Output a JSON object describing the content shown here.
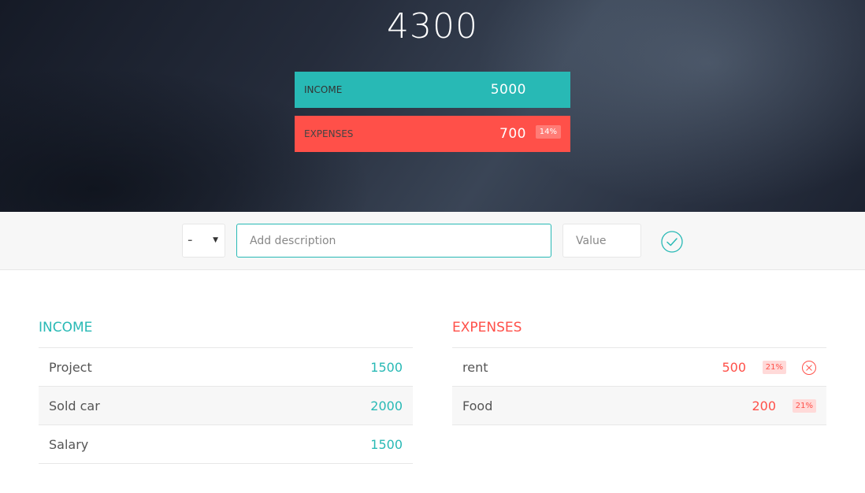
{
  "budget": {
    "available": "4300",
    "income_label": "Income",
    "income_value": "5000",
    "expenses_label": "Expenses",
    "expenses_value": "700",
    "expenses_percentage": "14%"
  },
  "add_form": {
    "type_value": "-",
    "description_placeholder": "Add description",
    "value_placeholder": "Value"
  },
  "income": {
    "title": "Income",
    "items": [
      {
        "description": "Project",
        "value": "1500"
      },
      {
        "description": "Sold car",
        "value": "2000"
      },
      {
        "description": "Salary",
        "value": "1500"
      }
    ]
  },
  "expenses": {
    "title": "Expenses",
    "items": [
      {
        "description": "rent",
        "value": "500",
        "percentage": "21%"
      },
      {
        "description": "Food",
        "value": "200",
        "percentage": "21%"
      }
    ]
  },
  "colors": {
    "income": "#28b9b5",
    "expenses": "#ff5049",
    "background": "#f7f7f7"
  },
  "icons": {
    "add": "checkmark-circle-icon",
    "delete": "close-circle-icon",
    "select": "caret-down-icon"
  }
}
